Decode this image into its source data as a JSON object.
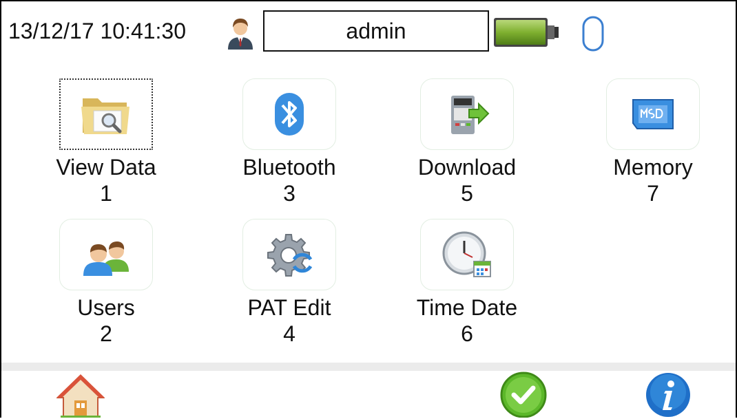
{
  "status_bar": {
    "datetime": "13/12/17 10:41:30",
    "user": "admin",
    "icons": [
      "user-icon",
      "battery-icon",
      "usb-icon"
    ]
  },
  "menu": [
    {
      "label": "View Data",
      "number": "1",
      "icon": "folder-search-icon",
      "selected": true
    },
    {
      "label": "Bluetooth",
      "number": "3",
      "icon": "bluetooth-icon",
      "selected": false
    },
    {
      "label": "Download",
      "number": "5",
      "icon": "download-icon",
      "selected": false
    },
    {
      "label": "Memory",
      "number": "7",
      "icon": "micro-sd-icon",
      "selected": false
    },
    {
      "label": "Users",
      "number": "2",
      "icon": "users-icon",
      "selected": false
    },
    {
      "label": "PAT Edit",
      "number": "4",
      "icon": "gear-sync-icon",
      "selected": false
    },
    {
      "label": "Time Date",
      "number": "6",
      "icon": "clock-calendar-icon",
      "selected": false
    }
  ],
  "footer": {
    "buttons": [
      "home-icon",
      "confirm-icon",
      "info-icon"
    ]
  },
  "colors": {
    "battery": "#7fb030",
    "usb": "#3b7fd0",
    "confirm": "#5cb82a",
    "info": "#1f6fc8"
  }
}
